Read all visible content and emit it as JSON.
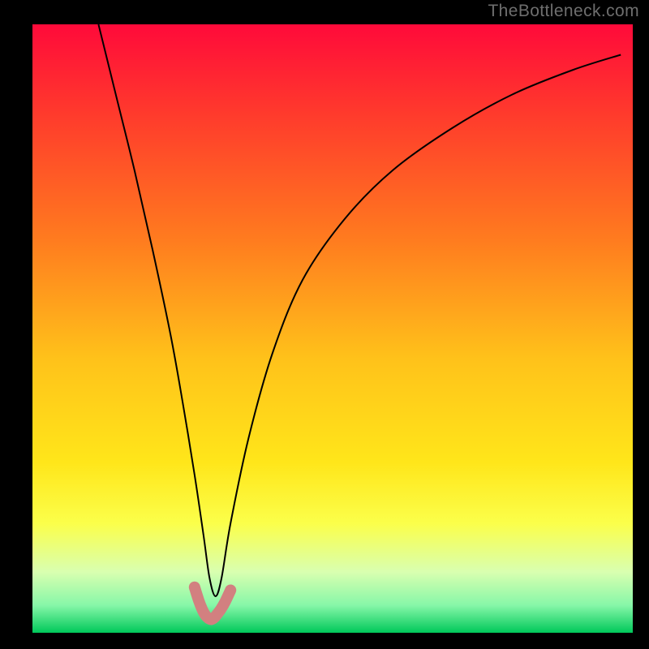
{
  "watermark": "TheBottleneck.com",
  "chart_data": {
    "type": "line",
    "title": "",
    "xlabel": "",
    "ylabel": "",
    "xlim": [
      0,
      100
    ],
    "ylim": [
      0,
      100
    ],
    "background_gradient_stops": [
      {
        "offset": 0.0,
        "color": "#ff0a3a"
      },
      {
        "offset": 0.15,
        "color": "#ff3b2c"
      },
      {
        "offset": 0.35,
        "color": "#ff7a1f"
      },
      {
        "offset": 0.55,
        "color": "#ffc21a"
      },
      {
        "offset": 0.72,
        "color": "#ffe61a"
      },
      {
        "offset": 0.82,
        "color": "#fbff4a"
      },
      {
        "offset": 0.9,
        "color": "#d9ffb0"
      },
      {
        "offset": 0.955,
        "color": "#86f7a8"
      },
      {
        "offset": 1.0,
        "color": "#00c85a"
      }
    ],
    "series": [
      {
        "name": "bottleneck-curve",
        "color": "#000000",
        "width": 2,
        "x": [
          11.0,
          14.0,
          17.0,
          20.0,
          23.0,
          25.0,
          27.0,
          28.5,
          29.5,
          30.5,
          31.5,
          33.0,
          36.0,
          40.0,
          45.0,
          52.0,
          60.0,
          70.0,
          80.0,
          90.0,
          98.0
        ],
        "y": [
          100.0,
          88.0,
          76.0,
          63.0,
          49.0,
          38.0,
          26.0,
          16.0,
          9.0,
          6.0,
          9.0,
          18.0,
          32.0,
          46.0,
          58.0,
          68.0,
          76.0,
          83.0,
          88.5,
          92.5,
          95.0
        ]
      },
      {
        "name": "optimal-zone-marker",
        "color": "#d28080",
        "width": 14,
        "linecap": "round",
        "x": [
          27.0,
          27.7,
          28.3,
          28.8,
          29.3,
          29.8,
          30.3,
          30.8,
          31.4,
          32.1,
          33.0
        ],
        "y": [
          7.5,
          5.3,
          3.8,
          2.9,
          2.4,
          2.2,
          2.5,
          3.1,
          3.9,
          5.1,
          7.0
        ]
      }
    ]
  }
}
